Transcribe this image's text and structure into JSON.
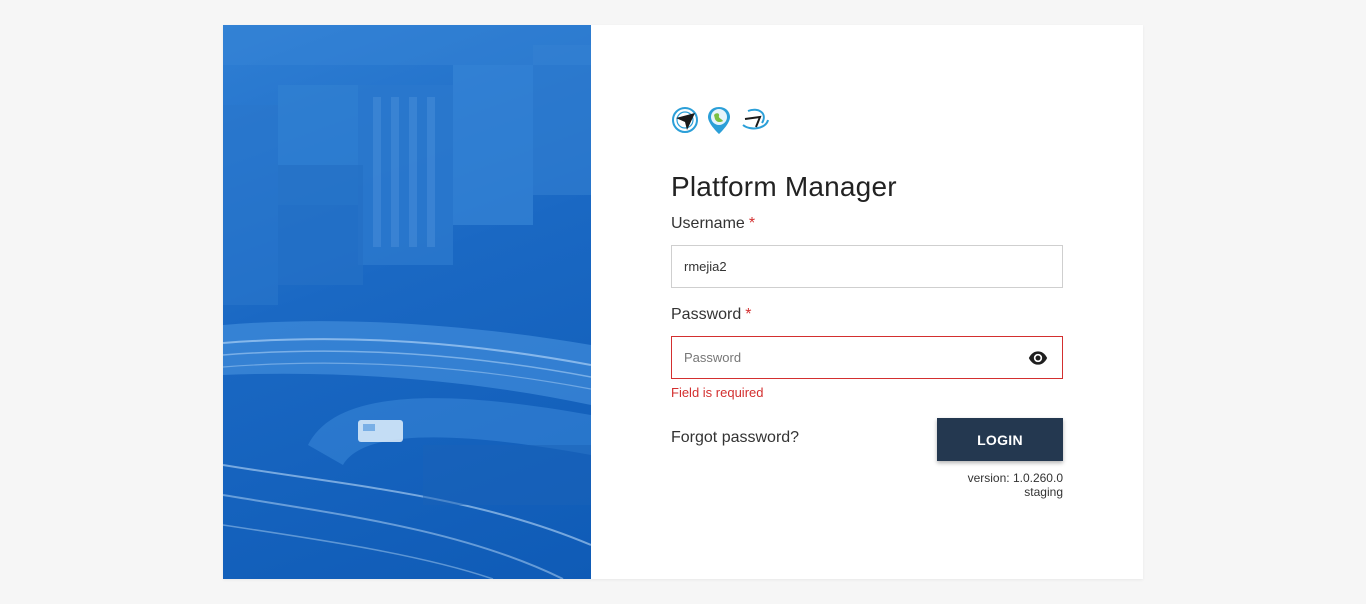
{
  "app": {
    "title": "Platform Manager"
  },
  "logos": [
    {
      "icon": "paper-plane-globe-icon"
    },
    {
      "icon": "map-pin-globe-icon"
    },
    {
      "icon": "orbit-swirl-icon"
    }
  ],
  "form": {
    "username": {
      "label": "Username",
      "required_mark": "*",
      "value": "rmejia2"
    },
    "password": {
      "label": "Password",
      "required_mark": "*",
      "value": "",
      "placeholder": "Password",
      "error": "Field is required",
      "toggle_icon": "eye-icon"
    },
    "forgot_label": "Forgot password?",
    "login_label": "LOGIN"
  },
  "footer": {
    "version": "version: 1.0.260.0",
    "environment": "staging"
  },
  "colors": {
    "primary": "#243850",
    "hero_blue": "#1a68c3",
    "error": "#d32f2f"
  }
}
